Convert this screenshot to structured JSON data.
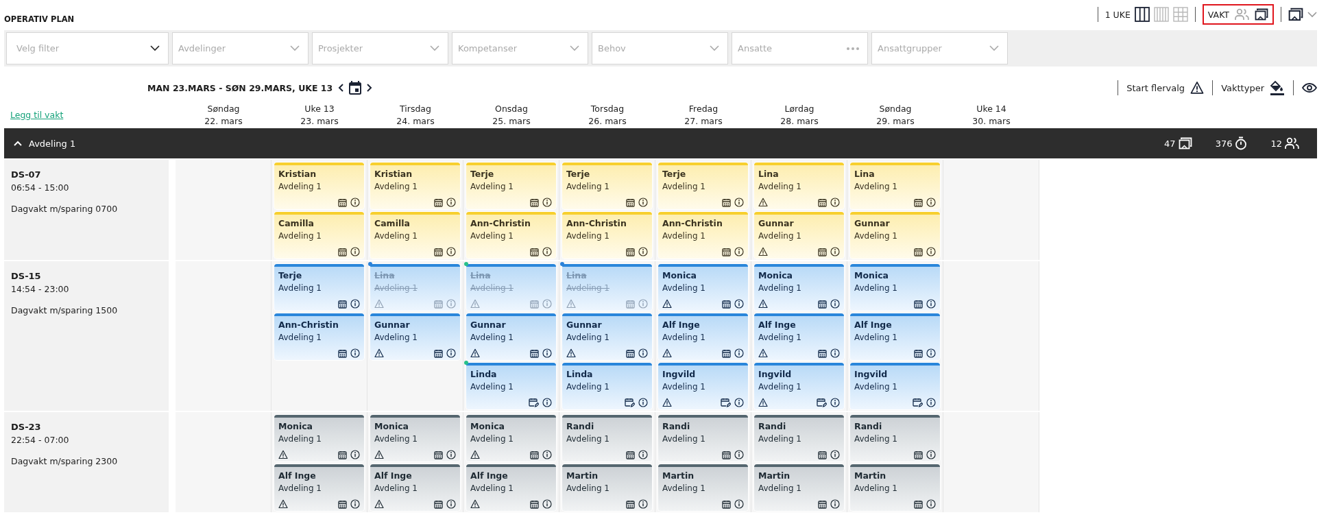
{
  "header": {
    "title": "OPERATIV PLAN",
    "period": "1 UKE",
    "views": [
      {
        "kind": "columns3",
        "selected": true
      },
      {
        "kind": "columns4",
        "selected": false
      },
      {
        "kind": "grid",
        "selected": false
      }
    ],
    "mode_label": "VAKT",
    "modes": [
      {
        "kind": "people",
        "selected": false
      },
      {
        "kind": "shifts",
        "selected": true
      }
    ]
  },
  "filters": [
    {
      "placeholder": "Velg filter",
      "kind": "primary"
    },
    {
      "placeholder": "Avdelinger",
      "kind": "dropdown"
    },
    {
      "placeholder": "Prosjekter",
      "kind": "dropdown"
    },
    {
      "placeholder": "Kompetanser",
      "kind": "dropdown"
    },
    {
      "placeholder": "Behov",
      "kind": "dropdown"
    },
    {
      "placeholder": "Ansatte",
      "kind": "lookup"
    },
    {
      "placeholder": "Ansattgrupper",
      "kind": "dropdown"
    }
  ],
  "navigation": {
    "range": "MAN 23.MARS - SØN 29.MARS, UKE 13",
    "multi_select": "Start flervalg",
    "shift_types": "Vakttyper"
  },
  "add_shift_link": "Legg til vakt",
  "columns": [
    {
      "day": "Søndag",
      "date": "22. mars"
    },
    {
      "day": "Uke 13",
      "date": "23. mars"
    },
    {
      "day": "Tirsdag",
      "date": "24. mars"
    },
    {
      "day": "Onsdag",
      "date": "25. mars"
    },
    {
      "day": "Torsdag",
      "date": "26. mars"
    },
    {
      "day": "Fredag",
      "date": "27. mars"
    },
    {
      "day": "Lørdag",
      "date": "28. mars"
    },
    {
      "day": "Søndag",
      "date": "29. mars"
    },
    {
      "day": "Uke 14",
      "date": "30. mars"
    }
  ],
  "group": {
    "title": "Avdeling 1",
    "expanded": true,
    "stats": [
      {
        "kind": "shifts",
        "value": "47"
      },
      {
        "kind": "hours",
        "value": "376"
      },
      {
        "kind": "people",
        "value": "12"
      }
    ]
  },
  "rows": [
    {
      "code": "DS-07",
      "time": "06:54 - 15:00",
      "description": "Dagvakt m/sparing 0700",
      "kind": "day",
      "cells": [
        [
          {
            "name": "Kristian",
            "department": "Avdeling 1",
            "warning": false,
            "cancelled": false,
            "edited": false
          },
          {
            "name": "Camilla",
            "department": "Avdeling 1",
            "warning": false,
            "cancelled": false,
            "edited": false
          }
        ],
        [
          {
            "name": "Kristian",
            "department": "Avdeling 1",
            "warning": false,
            "cancelled": false,
            "edited": false
          },
          {
            "name": "Camilla",
            "department": "Avdeling 1",
            "warning": false,
            "cancelled": false,
            "edited": false
          }
        ],
        [
          {
            "name": "Terje",
            "department": "Avdeling 1",
            "warning": false,
            "cancelled": false,
            "edited": false
          },
          {
            "name": "Ann-Christin",
            "department": "Avdeling 1",
            "warning": false,
            "cancelled": false,
            "edited": false
          }
        ],
        [
          {
            "name": "Terje",
            "department": "Avdeling 1",
            "warning": false,
            "cancelled": false,
            "edited": false
          },
          {
            "name": "Ann-Christin",
            "department": "Avdeling 1",
            "warning": false,
            "cancelled": false,
            "edited": false
          }
        ],
        [
          {
            "name": "Terje",
            "department": "Avdeling 1",
            "warning": false,
            "cancelled": false,
            "edited": false
          },
          {
            "name": "Ann-Christin",
            "department": "Avdeling 1",
            "warning": false,
            "cancelled": false,
            "edited": false
          }
        ],
        [
          {
            "name": "Lina",
            "department": "Avdeling 1",
            "warning": true,
            "cancelled": false,
            "edited": false
          },
          {
            "name": "Gunnar",
            "department": "Avdeling 1",
            "warning": true,
            "cancelled": false,
            "edited": false
          }
        ],
        [
          {
            "name": "Lina",
            "department": "Avdeling 1",
            "warning": false,
            "cancelled": false,
            "edited": false
          },
          {
            "name": "Gunnar",
            "department": "Avdeling 1",
            "warning": false,
            "cancelled": false,
            "edited": false
          }
        ]
      ]
    },
    {
      "code": "DS-15",
      "time": "14:54 - 23:00",
      "description": "Dagvakt m/sparing 1500",
      "kind": "evening",
      "cells": [
        [
          {
            "name": "Terje",
            "department": "Avdeling 1",
            "warning": false,
            "cancelled": false,
            "edited": false
          },
          {
            "name": "Ann-Christin",
            "department": "Avdeling 1",
            "warning": false,
            "cancelled": false,
            "edited": false
          }
        ],
        [
          {
            "name": "Lina",
            "department": "Avdeling 1",
            "warning": true,
            "cancelled": true,
            "edited": false,
            "color": "#2b82d9"
          },
          {
            "name": "Gunnar",
            "department": "Avdeling 1",
            "warning": true,
            "cancelled": false,
            "edited": false
          }
        ],
        [
          {
            "name": "Lina",
            "department": "Avdeling 1",
            "warning": true,
            "cancelled": true,
            "edited": false,
            "color": "#27c08a"
          },
          {
            "name": "Gunnar",
            "department": "Avdeling 1",
            "warning": true,
            "cancelled": false,
            "edited": false
          },
          {
            "name": "Linda",
            "department": "Avdeling 1",
            "warning": false,
            "cancelled": false,
            "edited": true,
            "color": "#27c08a"
          }
        ],
        [
          {
            "name": "Lina",
            "department": "Avdeling 1",
            "warning": true,
            "cancelled": true,
            "edited": false,
            "color": "#2b82d9"
          },
          {
            "name": "Gunnar",
            "department": "Avdeling 1",
            "warning": true,
            "cancelled": false,
            "edited": false
          },
          {
            "name": "Linda",
            "department": "Avdeling 1",
            "warning": false,
            "cancelled": false,
            "edited": true
          }
        ],
        [
          {
            "name": "Monica",
            "department": "Avdeling 1",
            "warning": true,
            "cancelled": false,
            "edited": false
          },
          {
            "name": "Alf Inge",
            "department": "Avdeling 1",
            "warning": true,
            "cancelled": false,
            "edited": false
          },
          {
            "name": "Ingvild",
            "department": "Avdeling 1",
            "warning": true,
            "cancelled": false,
            "edited": true
          }
        ],
        [
          {
            "name": "Monica",
            "department": "Avdeling 1",
            "warning": true,
            "cancelled": false,
            "edited": false
          },
          {
            "name": "Alf Inge",
            "department": "Avdeling 1",
            "warning": true,
            "cancelled": false,
            "edited": false
          },
          {
            "name": "Ingvild",
            "department": "Avdeling 1",
            "warning": true,
            "cancelled": false,
            "edited": true
          }
        ],
        [
          {
            "name": "Monica",
            "department": "Avdeling 1",
            "warning": false,
            "cancelled": false,
            "edited": false
          },
          {
            "name": "Alf Inge",
            "department": "Avdeling 1",
            "warning": false,
            "cancelled": false,
            "edited": false
          },
          {
            "name": "Ingvild",
            "department": "Avdeling 1",
            "warning": false,
            "cancelled": false,
            "edited": true
          }
        ]
      ]
    },
    {
      "code": "DS-23",
      "time": "22:54 - 07:00",
      "description": "Dagvakt m/sparing 2300",
      "kind": "night",
      "cells": [
        [
          {
            "name": "Monica",
            "department": "Avdeling 1",
            "warning": true,
            "cancelled": false,
            "edited": false
          },
          {
            "name": "Alf Inge",
            "department": "Avdeling 1",
            "warning": true,
            "cancelled": false,
            "edited": false
          }
        ],
        [
          {
            "name": "Monica",
            "department": "Avdeling 1",
            "warning": true,
            "cancelled": false,
            "edited": false
          },
          {
            "name": "Alf Inge",
            "department": "Avdeling 1",
            "warning": true,
            "cancelled": false,
            "edited": false
          }
        ],
        [
          {
            "name": "Monica",
            "department": "Avdeling 1",
            "warning": true,
            "cancelled": false,
            "edited": false
          },
          {
            "name": "Alf Inge",
            "department": "Avdeling 1",
            "warning": true,
            "cancelled": false,
            "edited": false
          }
        ],
        [
          {
            "name": "Randi",
            "department": "Avdeling 1",
            "warning": false,
            "cancelled": false,
            "edited": false
          },
          {
            "name": "Martin",
            "department": "Avdeling 1",
            "warning": false,
            "cancelled": false,
            "edited": false
          }
        ],
        [
          {
            "name": "Randi",
            "department": "Avdeling 1",
            "warning": false,
            "cancelled": false,
            "edited": false
          },
          {
            "name": "Martin",
            "department": "Avdeling 1",
            "warning": false,
            "cancelled": false,
            "edited": false
          }
        ],
        [
          {
            "name": "Randi",
            "department": "Avdeling 1",
            "warning": false,
            "cancelled": false,
            "edited": false
          },
          {
            "name": "Martin",
            "department": "Avdeling 1",
            "warning": false,
            "cancelled": false,
            "edited": false
          }
        ],
        [
          {
            "name": "Randi",
            "department": "Avdeling 1",
            "warning": false,
            "cancelled": false,
            "edited": false
          },
          {
            "name": "Martin",
            "department": "Avdeling 1",
            "warning": false,
            "cancelled": false,
            "edited": false
          }
        ]
      ]
    }
  ]
}
